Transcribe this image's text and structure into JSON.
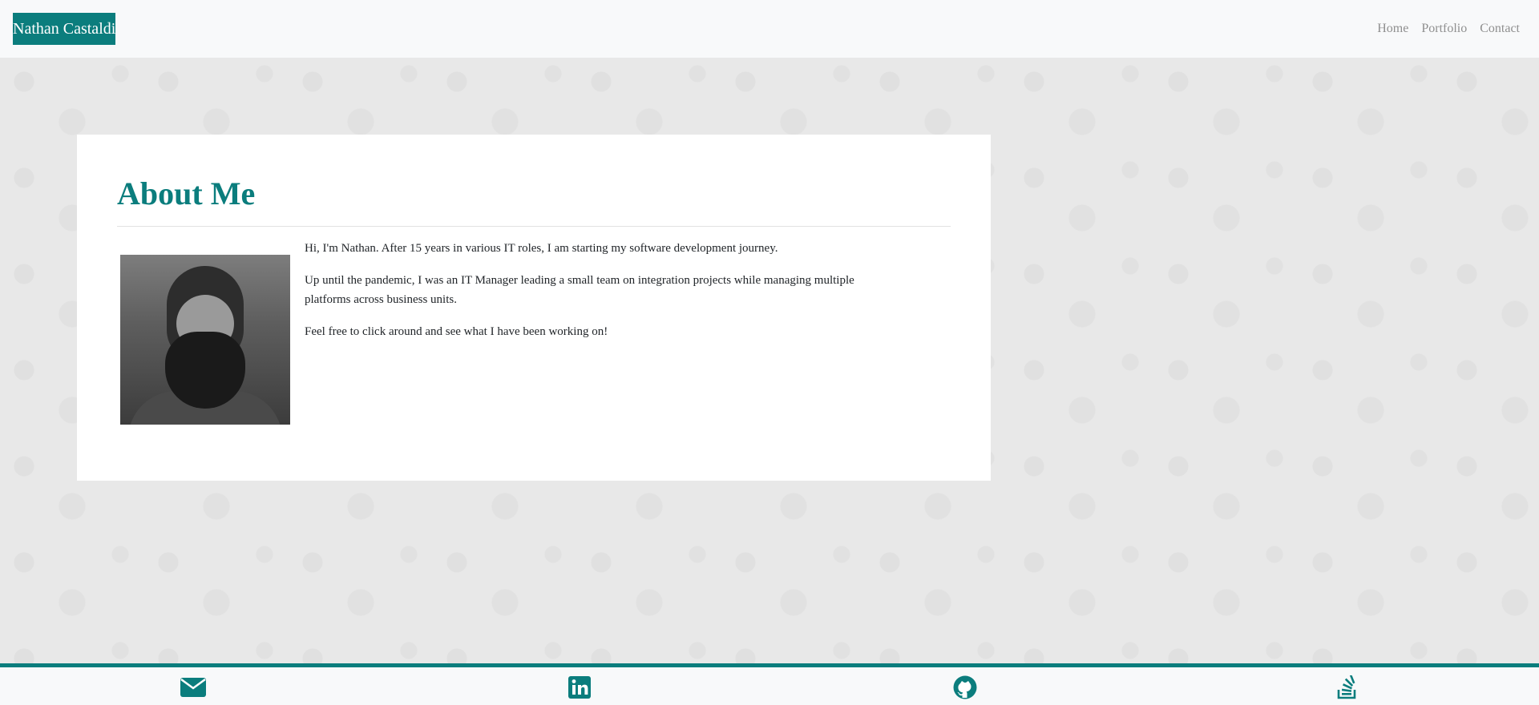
{
  "navbar": {
    "brand": "Nathan Castaldi",
    "links": [
      "Home",
      "Portfolio",
      "Contact"
    ]
  },
  "about": {
    "title": "About Me",
    "paragraphs": [
      "Hi, I'm Nathan. After 15 years in various IT roles, I am starting my software development journey.",
      "Up until the pandemic, I was an IT Manager leading a small team on integration projects while managing multiple platforms across business units.",
      "Feel free to click around and see what I have been working on!"
    ]
  },
  "footer": {
    "icons": [
      "envelope-icon",
      "linkedin-icon",
      "github-icon",
      "stackoverflow-icon"
    ]
  },
  "colors": {
    "accent": "#0b7d7d",
    "background": "#e9e9e9",
    "nav_background": "#f8f9fa",
    "nav_link": "#8f8f8f"
  }
}
